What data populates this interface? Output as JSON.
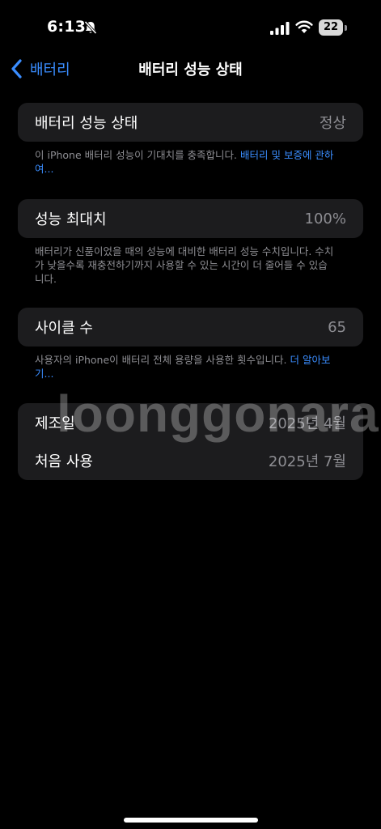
{
  "status_bar": {
    "time": "6:13",
    "battery_level": "22",
    "icons": [
      "bell-slash-icon",
      "signal-icon",
      "wifi-icon",
      "battery-icon"
    ]
  },
  "nav": {
    "back_label": "배터리",
    "title": "배터리 성능 상태"
  },
  "health": {
    "label": "배터리 성능 상태",
    "value": "정상",
    "note_text": "이 iPhone 배터리 성능이 기대치를 충족합니다. ",
    "note_link": "배터리 및 보증에 관하여..."
  },
  "capacity": {
    "label": "성능 최대치",
    "value": "100%",
    "note_text": "배터리가 신품이었을 때의 성능에 대비한 배터리 성능 수치입니다. 수치가 낮을수록 재충전하기까지 사용할 수 있는 시간이 더 줄어들 수 있습니다."
  },
  "cycles": {
    "label": "사이클 수",
    "value": "65",
    "note_text": "사용자의 iPhone이 배터리 전체 용량을 사용한 횟수입니다. ",
    "note_link": "더 알아보기..."
  },
  "dates": {
    "manufacture_label": "제조일",
    "manufacture_value": "2025년 4월",
    "first_use_label": "처음 사용",
    "first_use_value": "2025년 7월"
  },
  "watermark": "loonggonara",
  "colors": {
    "background": "#000000",
    "card": "#1c1c1e",
    "secondary_text": "#8e8e93",
    "accent": "#3a8dff"
  }
}
